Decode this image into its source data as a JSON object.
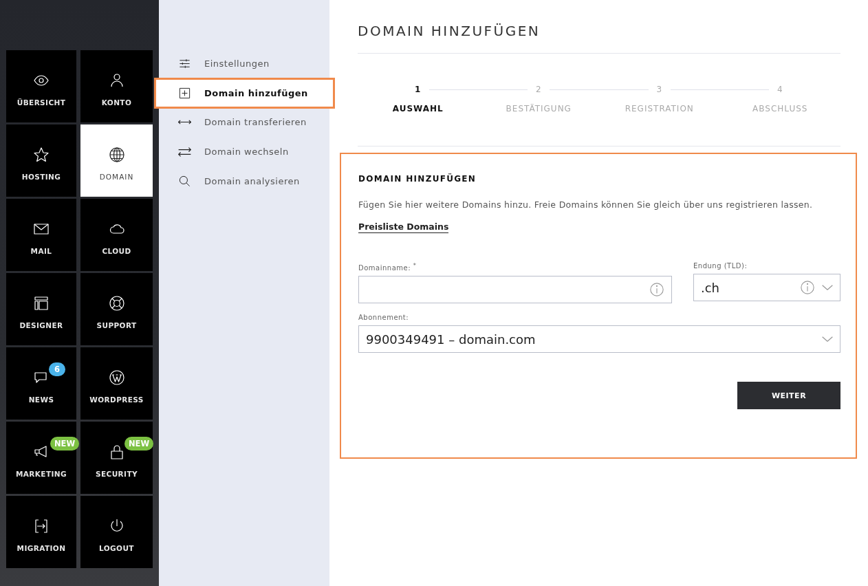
{
  "tiles": [
    {
      "label": "ÜBERSICHT",
      "selected": false
    },
    {
      "label": "KONTO",
      "selected": false
    },
    {
      "label": "HOSTING",
      "selected": false
    },
    {
      "label": "DOMAIN",
      "selected": true
    },
    {
      "label": "MAIL",
      "selected": false
    },
    {
      "label": "CLOUD",
      "selected": false
    },
    {
      "label": "DESIGNER",
      "selected": false
    },
    {
      "label": "SUPPORT",
      "selected": false
    },
    {
      "label": "NEWS",
      "selected": false,
      "badge": {
        "text": "6",
        "color": "#4ab3ea"
      }
    },
    {
      "label": "WORDPRESS",
      "selected": false
    },
    {
      "label": "MARKETING",
      "selected": false,
      "badge": {
        "text": "NEW",
        "color": "#7cc142"
      }
    },
    {
      "label": "SECURITY",
      "selected": false,
      "badge": {
        "text": "NEW",
        "color": "#7cc142"
      }
    },
    {
      "label": "MIGRATION",
      "selected": false
    },
    {
      "label": "LOGOUT",
      "selected": false
    }
  ],
  "submenu": [
    {
      "label": "Einstellungen",
      "selected": false
    },
    {
      "label": "Domain hinzufügen",
      "selected": true
    },
    {
      "label": "Domain transferieren",
      "selected": false
    },
    {
      "label": "Domain wechseln",
      "selected": false
    },
    {
      "label": "Domain analysieren",
      "selected": false
    }
  ],
  "page_title": "DOMAIN HINZUFÜGEN",
  "steps": [
    {
      "number": "1",
      "label": "AUSWAHL",
      "selected": true
    },
    {
      "number": "2",
      "label": "BESTÄTIGUNG",
      "selected": false
    },
    {
      "number": "3",
      "label": "REGISTRATION",
      "selected": false
    },
    {
      "number": "4",
      "label": "ABSCHLUSS",
      "selected": false
    }
  ],
  "card": {
    "title": "DOMAIN HINZUFÜGEN",
    "description": "Fügen Sie hier weitere Domains hinzu. Freie Domains können Sie gleich über uns registrieren lassen.",
    "link": "Preisliste Domains",
    "fields": [
      {
        "kind": "text",
        "label": "Domainname: $^{*}$",
        "info": true
      },
      {
        "kind": "select",
        "label": "Endung (TLD):",
        "value": ".ch",
        "info": true
      },
      {
        "kind": "select",
        "label": "Abonnement:",
        "value": "9900349491 – domain.com",
        "info": false
      }
    ],
    "button": "WEITER"
  }
}
